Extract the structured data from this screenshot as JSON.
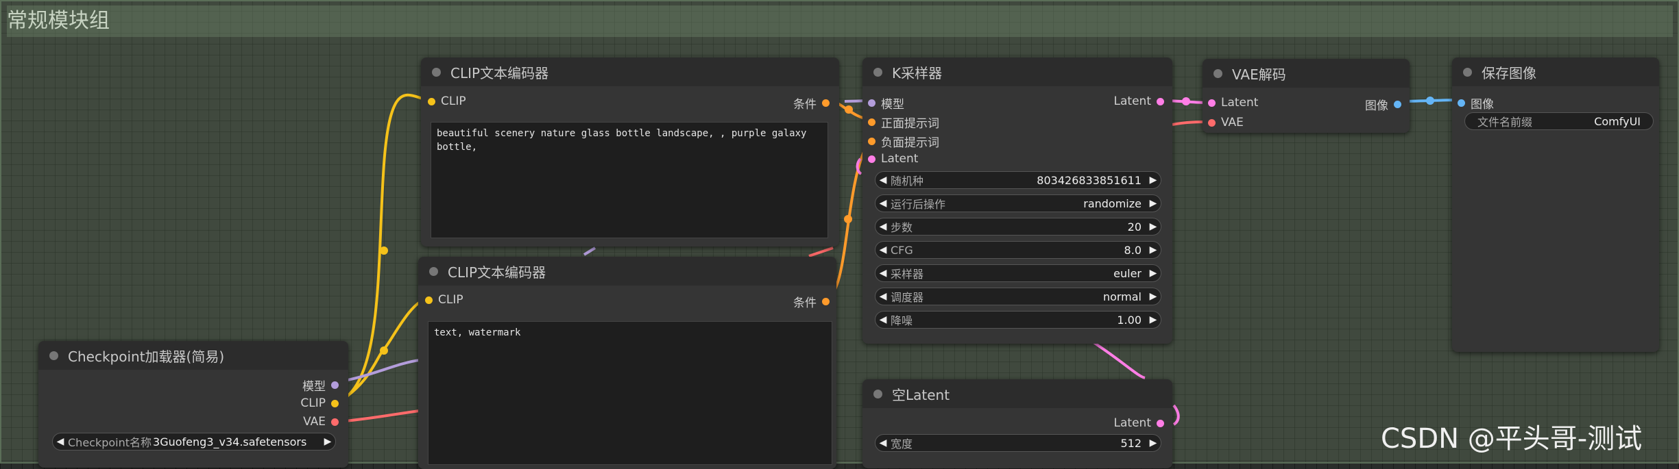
{
  "group": {
    "title": "常规模块组"
  },
  "clip_top": {
    "title": "CLIP文本编码器",
    "input": "CLIP",
    "output": "条件",
    "text": "beautiful scenery nature glass bottle landscape, , purple galaxy bottle,"
  },
  "clip_bottom": {
    "title": "CLIP文本编码器",
    "input": "CLIP",
    "output": "条件",
    "text": "text, watermark"
  },
  "checkpoint": {
    "title": "Checkpoint加载器(简易)",
    "outputs": [
      "模型",
      "CLIP",
      "VAE"
    ],
    "widget_label": "Checkpoint名称",
    "widget_value": "3Guofeng3_v34.safetensors"
  },
  "ksampler": {
    "title": "K采样器",
    "inputs": [
      "模型",
      "正面提示词",
      "负面提示词",
      "Latent"
    ],
    "output": "Latent",
    "widgets": [
      {
        "label": "随机种",
        "value": "803426833851611"
      },
      {
        "label": "运行后操作",
        "value": "randomize"
      },
      {
        "label": "步数",
        "value": "20"
      },
      {
        "label": "CFG",
        "value": "8.0"
      },
      {
        "label": "采样器",
        "value": "euler"
      },
      {
        "label": "调度器",
        "value": "normal"
      },
      {
        "label": "降噪",
        "value": "1.00"
      }
    ]
  },
  "vae_decode": {
    "title": "VAE解码",
    "inputs": [
      "Latent",
      "VAE"
    ],
    "output": "图像"
  },
  "save_image": {
    "title": "保存图像",
    "input": "图像",
    "widget_label": "文件名前缀",
    "widget_value": "ComfyUI"
  },
  "empty_latent": {
    "title": "空Latent",
    "output": "Latent",
    "widget_label": "宽度",
    "widget_value": "512"
  },
  "watermark": {
    "text": "CSDN @平头哥-测试"
  },
  "colors": {
    "clip": "#f5c21a",
    "conditioning": "#ff9b2b",
    "model": "#b39ddb",
    "latent": "#ff7ee6",
    "vae": "#ff6b6b",
    "image": "#64b5f6"
  }
}
